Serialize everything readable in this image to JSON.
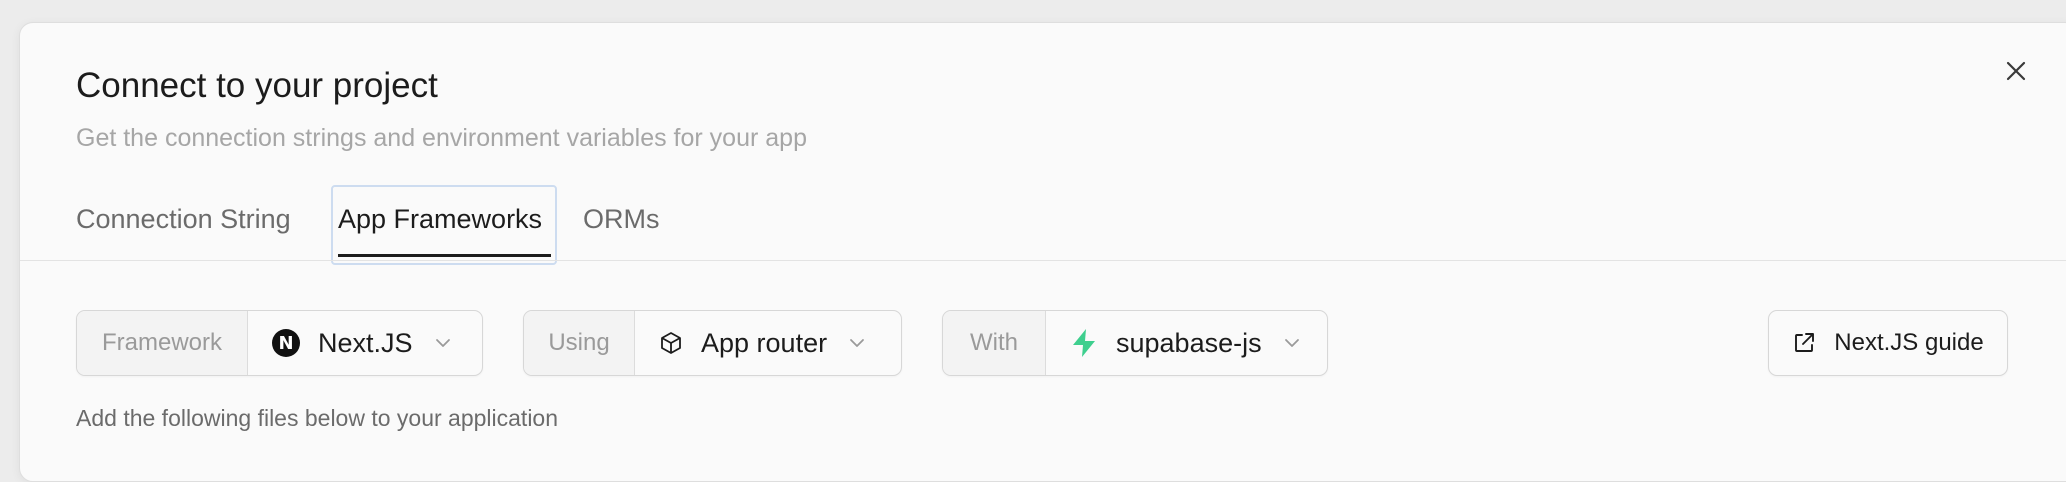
{
  "dialog": {
    "title": "Connect to your project",
    "subtitle": "Get the connection strings and environment variables for your app",
    "close_icon": "close-icon"
  },
  "tabs": [
    {
      "label": "Connection String",
      "active": false
    },
    {
      "label": "App Frameworks",
      "active": true
    },
    {
      "label": "ORMs",
      "active": false
    }
  ],
  "selectors": {
    "framework": {
      "label": "Framework",
      "value": "Next.JS",
      "icon": "nextjs-logo-icon"
    },
    "using": {
      "label": "Using",
      "value": "App router",
      "icon": "cube-icon"
    },
    "with": {
      "label": "With",
      "value": "supabase-js",
      "icon": "supabase-bolt-icon"
    }
  },
  "guide_button": {
    "label": "Next.JS guide",
    "icon": "external-link-icon"
  },
  "hint": "Add the following files below to your application",
  "colors": {
    "accent_focus": "#cddcf0",
    "supabase_green": "#3ecf8e",
    "text_primary": "#1c1c1c",
    "text_muted": "#a6a6a6"
  }
}
